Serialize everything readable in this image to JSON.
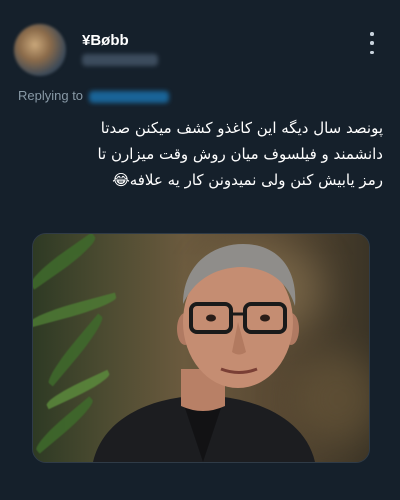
{
  "tweet": {
    "display_name": "¥Bøbb",
    "replying_label": "Replying to",
    "text_lines": [
      "پونصد سال دیگه این کاغذو کشف میکنن صدتا",
      "دانشمند و فیلسوف میان روش وقت میزارن تا",
      "رمز یابیش کنن ولی نمیدونن کار یه علافه"
    ],
    "emoji": "😂"
  },
  "colors": {
    "background": "#15202b",
    "accent": "#1d9bf0",
    "secondary_text": "#8899a6"
  },
  "icons": {
    "more": "more-vertical-icon",
    "emoji": "face-with-tears-of-joy-icon"
  }
}
